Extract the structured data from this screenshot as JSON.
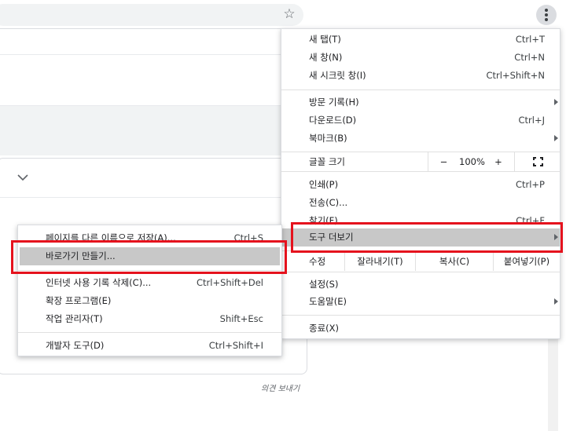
{
  "toolbar": {
    "bookmark_icon": "star-icon",
    "menu_icon": "more-vertical-icon"
  },
  "page": {
    "feedback_text": "의견 보내기"
  },
  "menu": {
    "items": [
      {
        "label": "새 탭(T)",
        "shortcut": "Ctrl+T"
      },
      {
        "label": "새 창(N)",
        "shortcut": "Ctrl+N"
      },
      {
        "label": "새 시크릿 창(I)",
        "shortcut": "Ctrl+Shift+N"
      },
      {
        "label": "방문 기록(H)",
        "shortcut": ""
      },
      {
        "label": "다운로드(D)",
        "shortcut": "Ctrl+J"
      },
      {
        "label": "북마크(B)",
        "shortcut": ""
      },
      {
        "label": "인쇄(P)",
        "shortcut": "Ctrl+P"
      },
      {
        "label": "전송(C)...",
        "shortcut": ""
      },
      {
        "label": "찾기(F)...",
        "shortcut": "Ctrl+F"
      },
      {
        "label": "도구 더보기",
        "shortcut": ""
      },
      {
        "label": "설정(S)",
        "shortcut": ""
      },
      {
        "label": "도움말(E)",
        "shortcut": ""
      },
      {
        "label": "종료(X)",
        "shortcut": ""
      }
    ],
    "zoom": {
      "label": "글꼴 크기",
      "minus": "−",
      "value": "100%",
      "plus": "+"
    },
    "edit": {
      "label": "수정",
      "cut": "잘라내기(T)",
      "copy": "복사(C)",
      "paste": "붙여넣기(P)"
    }
  },
  "submenu": {
    "items": [
      {
        "label": "페이지를 다른 이름으로 저장(A)...",
        "shortcut": "Ctrl+S"
      },
      {
        "label": "바로가기 만들기...",
        "shortcut": ""
      },
      {
        "label": "인터넷 사용 기록 삭제(C)...",
        "shortcut": "Ctrl+Shift+Del"
      },
      {
        "label": "확장 프로그램(E)",
        "shortcut": ""
      },
      {
        "label": "작업 관리자(T)",
        "shortcut": "Shift+Esc"
      },
      {
        "label": "개발자 도구(D)",
        "shortcut": "Ctrl+Shift+I"
      }
    ]
  },
  "colors": {
    "highlight": "#c8c8c8",
    "annotation_red": "#e5121d"
  }
}
